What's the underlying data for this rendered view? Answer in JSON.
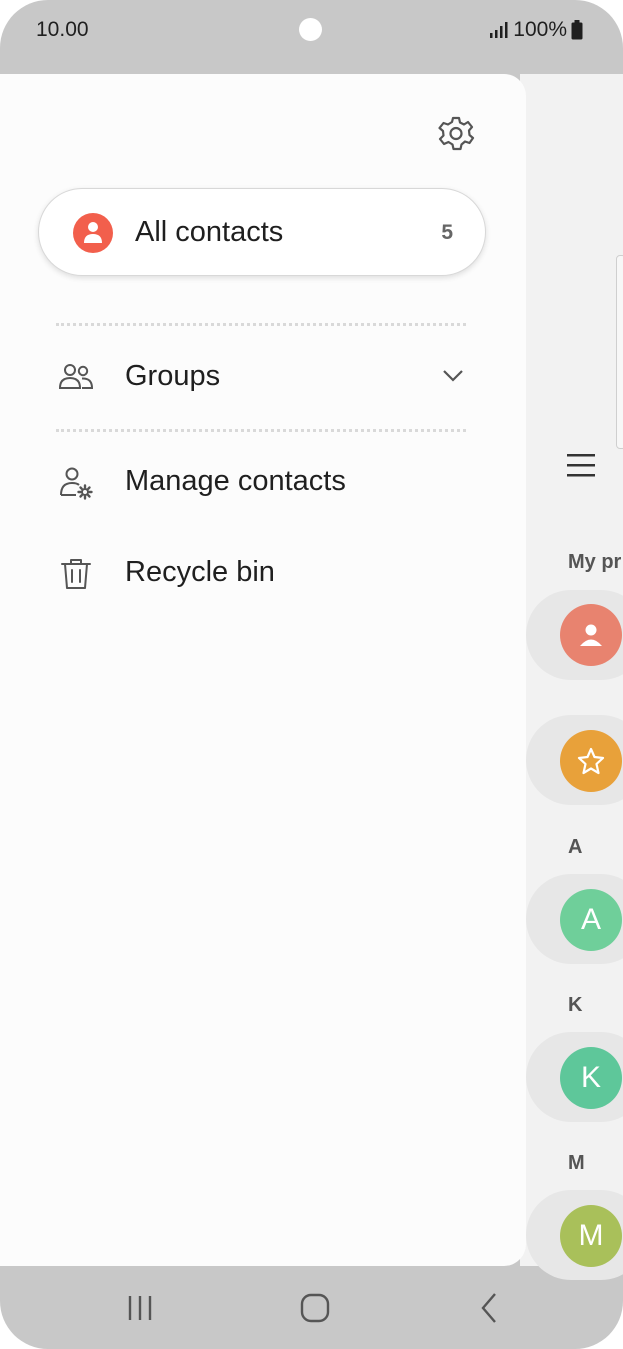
{
  "status": {
    "time": "10.00",
    "battery": "100%"
  },
  "drawer": {
    "all_contacts": {
      "label": "All contacts",
      "count": "5"
    },
    "menu": [
      {
        "label": "Groups"
      },
      {
        "label": "Manage contacts"
      },
      {
        "label": "Recycle bin"
      }
    ]
  },
  "background": {
    "section_my_profile": "My pr",
    "section_a": "A",
    "section_k": "K",
    "section_m": "M",
    "avatar_a": "A",
    "avatar_k": "K",
    "avatar_m": "M"
  },
  "colors": {
    "accent": "#f25f4c",
    "favorites": "#e8a13a",
    "contact_a": "#6fcf9a",
    "contact_k": "#5ec79a",
    "contact_m": "#a9c05a"
  },
  "icons": [
    "settings-gear-icon",
    "person-icon",
    "group-icon",
    "chevron-down-icon",
    "manage-contacts-icon",
    "trash-icon",
    "menu-icon",
    "recent-apps-icon",
    "home-icon",
    "back-icon"
  ]
}
